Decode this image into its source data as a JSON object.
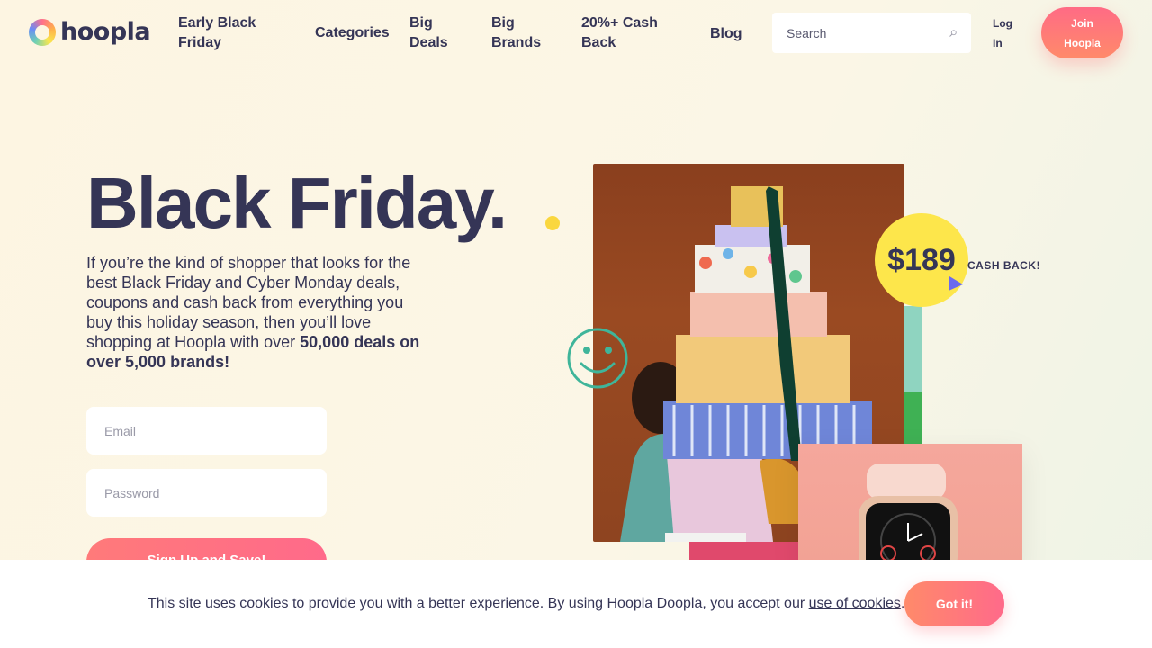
{
  "brand": {
    "name": "hoopla"
  },
  "nav": {
    "items": [
      {
        "label_line1": "Early Black",
        "label_line2": "Friday"
      },
      {
        "label_line1": "Categories",
        "label_line2": ""
      },
      {
        "label_line1": "Big",
        "label_line2": "Deals"
      },
      {
        "label_line1": "Big",
        "label_line2": "Brands"
      },
      {
        "label_line1": "20%+ Cash",
        "label_line2": "Back"
      },
      {
        "label_line1": "Blog",
        "label_line2": ""
      }
    ]
  },
  "search": {
    "placeholder": "Search"
  },
  "auth": {
    "login_line1": "Log",
    "login_line2": "In",
    "join_line1": "Join",
    "join_line2": "Hoopla"
  },
  "hero": {
    "title": "Black Friday.",
    "text": "If you’re the kind of shopper that looks for the best Black Friday and Cyber Monday deals, coupons and cash back from everything you buy this holiday season, then you’ll love shopping at Hoopla with over ",
    "text_bold": "50,000 deals on over 5,000 brands!",
    "email_placeholder": "Email",
    "password_placeholder": "Password",
    "signup_label": "Sign Up and Save!"
  },
  "promo": {
    "price": "$189",
    "cash_back": "CASH BACK!"
  },
  "cookie": {
    "text": "This site uses cookies to provide you with a better experience. By using Hoopla Doopla, you accept our ",
    "link": "use of cookies",
    "suffix": ".",
    "button": "Got it!"
  },
  "colors": {
    "accent_pink": "#ff6b85",
    "accent_orange": "#ff8a6a",
    "text_dark": "#353556",
    "badge_yellow": "#fde64b",
    "smiley_teal": "#3fb59a"
  }
}
